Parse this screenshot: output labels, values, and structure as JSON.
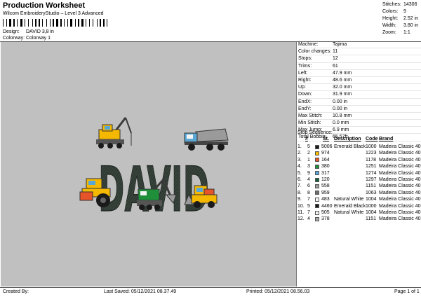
{
  "header": {
    "title": "Production Worksheet",
    "subtitle": "Wilcom EmbroideryStudio – Level 3 Advanced",
    "design_label": "Design:",
    "design_value": "DAVID 3,8 in",
    "colorway_label": "Colorway:",
    "colorway_value": "Colorway 1"
  },
  "stats": [
    {
      "label": "Stitches:",
      "value": "14306"
    },
    {
      "label": "Colors:",
      "value": "9"
    },
    {
      "label": "Height:",
      "value": "2.52 in"
    },
    {
      "label": "Width:",
      "value": "3.80 in"
    },
    {
      "label": "Zoom:",
      "value": "1:1"
    }
  ],
  "design_text": "DAVID",
  "machine_info": [
    {
      "label": "Machine:",
      "value": "Tajima"
    },
    {
      "label": "Color changes:",
      "value": "11"
    },
    {
      "label": "Stops:",
      "value": "12"
    },
    {
      "label": "Trims:",
      "value": "61"
    },
    {
      "label": "Left:",
      "value": "47.9 mm"
    },
    {
      "label": "Right:",
      "value": "48.6 mm"
    },
    {
      "label": "Up:",
      "value": "32.0 mm"
    },
    {
      "label": "Down:",
      "value": "31.9 mm"
    },
    {
      "label": "EndX:",
      "value": "0.00 in"
    },
    {
      "label": "EndY:",
      "value": "0.00 in"
    },
    {
      "label": "Max Stitch:",
      "value": "10.8 mm"
    },
    {
      "label": "Min Stitch:",
      "value": "0.0 mm"
    },
    {
      "label": "Max Jump:",
      "value": "6.9 mm"
    },
    {
      "label": "Total Bobbin:",
      "value": "65.57ft"
    }
  ],
  "stop_sequence": {
    "label": "Stop Sequence:",
    "columns": {
      "n": "#",
      "st": "St.",
      "description": "Description",
      "code": "Code",
      "brand": "Brand"
    },
    "rows": [
      {
        "idx": "1.",
        "n": "5",
        "color": "#1a1a1a",
        "st": "5006",
        "description": "Emerald Black",
        "code": "1000",
        "brand": "Madeira Classic 40"
      },
      {
        "idx": "2.",
        "n": "2",
        "color": "#f5b800",
        "st": "974",
        "description": "",
        "code": "1223",
        "brand": "Madeira Classic 40"
      },
      {
        "idx": "3.",
        "n": "1",
        "color": "#e8542a",
        "st": "164",
        "description": "",
        "code": "1178",
        "brand": "Madeira Classic 40"
      },
      {
        "idx": "4.",
        "n": "3",
        "color": "#1f8f3a",
        "st": "380",
        "description": "",
        "code": "1251",
        "brand": "Madeira Classic 40"
      },
      {
        "idx": "5.",
        "n": "9",
        "color": "#5aa7d6",
        "st": "317",
        "description": "",
        "code": "1274",
        "brand": "Madeira Classic 40"
      },
      {
        "idx": "6.",
        "n": "4",
        "color": "#0e5f3a",
        "st": "120",
        "description": "",
        "code": "1297",
        "brand": "Madeira Classic 40"
      },
      {
        "idx": "7.",
        "n": "6",
        "color": "#9a9a9a",
        "st": "558",
        "description": "",
        "code": "1151",
        "brand": "Madeira Classic 40"
      },
      {
        "idx": "8.",
        "n": "8",
        "color": "#6e6e6e",
        "st": "959",
        "description": "",
        "code": "1063",
        "brand": "Madeira Classic 40"
      },
      {
        "idx": "9.",
        "n": "7",
        "color": "#f4f4f4",
        "st": "483",
        "description": "Natural White",
        "code": "1004",
        "brand": "Madeira Classic 40"
      },
      {
        "idx": "10.",
        "n": "5",
        "color": "#1a1a1a",
        "st": "4460",
        "description": "Emerald Black",
        "code": "1000",
        "brand": "Madeira Classic 40"
      },
      {
        "idx": "11.",
        "n": "7",
        "color": "#f4f4f4",
        "st": "505",
        "description": "Natural White",
        "code": "1004",
        "brand": "Madeira Classic 40"
      },
      {
        "idx": "12.",
        "n": "4",
        "color": "#a8a8a8",
        "st": "378",
        "description": "",
        "code": "1151",
        "brand": "Madeira Classic 40"
      }
    ]
  },
  "footer": {
    "created_by": "Created By:",
    "last_saved": "Last Saved: 05/12/2021 08.37.49",
    "printed": "Printed: 05/12/2021 08.56.03",
    "page": "Page 1 of 1"
  }
}
